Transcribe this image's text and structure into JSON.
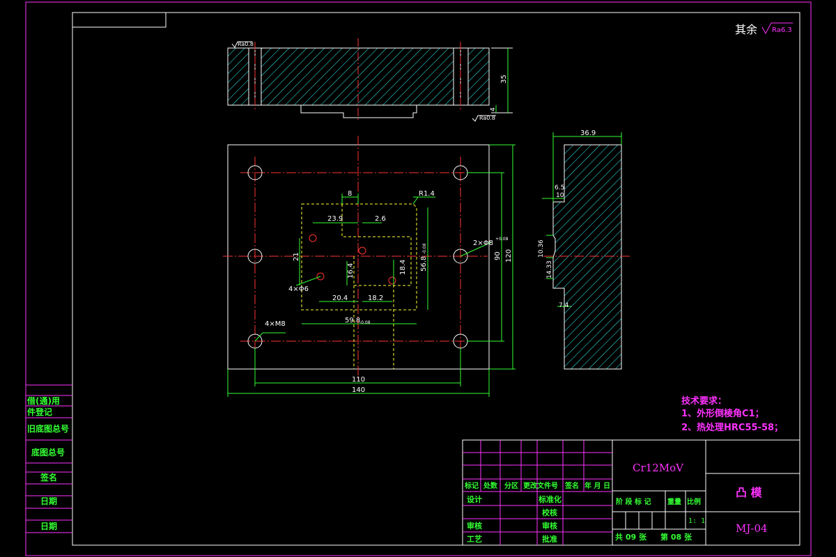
{
  "roughness": {
    "general_prefix": "其余",
    "general_value": "Ra6.3",
    "top_left_value": "Ra0.8",
    "bottom_value": "Ra0.8"
  },
  "front_view": {
    "dim_35": "35",
    "dim_4": "4"
  },
  "plan_view": {
    "dim_8": "8",
    "dim_R14": "R1.4",
    "dim_23_9": "23.9",
    "dim_2_6": "2.6",
    "dim_2xphi": "2×Φ8",
    "dim_2xphi_tol": "+0.08",
    "dim_21": "21",
    "dim_16_4": "16.4",
    "dim_4xphi6": "4×Φ6",
    "dim_18_4": "18.4",
    "dim_56_8": "56.8",
    "dim_56_8_tol": "-0.08",
    "dim_90": "90",
    "dim_120": "120",
    "dim_20_4": "20.4",
    "dim_18_2": "18.2",
    "dim_59_8": "59.8",
    "dim_59_8_tol": "-0.08",
    "dim_4xM8": "4×M8",
    "dim_110": "110",
    "dim_140": "140"
  },
  "side_view": {
    "dim_36_9": "36.9",
    "dim_6_5": "6.5",
    "dim_10": "10",
    "dim_10_36": "10.36",
    "dim_14_33": "14.33",
    "dim_7_4": "7.4"
  },
  "tech_requirements": {
    "title": "技术要求：",
    "item1": "1、外形倒棱角C1；",
    "item2": "2、热处理HRC55-58；"
  },
  "left_stamps": [
    "借(通)用",
    "件登记",
    "旧底图总号",
    "底图总号",
    "签名",
    "日期",
    "日期"
  ],
  "title_block": {
    "material": "Cr12MoV",
    "part_name": "凸  模",
    "drawing_no": "MJ-04",
    "rev_headers": [
      "标记",
      "处数",
      "分区",
      "更改文件号",
      "签名",
      "年 月 日"
    ],
    "design": "设计",
    "standardize": "标准化",
    "review": "审核",
    "process": "工艺",
    "check": "审核",
    "approve": "批准",
    "proofread": "校核",
    "stage_label": "阶 段 标 记",
    "weight_label": "重量",
    "scale_label": "比例",
    "scale": "1: 1",
    "sheet_total": "共 09 张",
    "sheet_no": "第 08 张"
  }
}
